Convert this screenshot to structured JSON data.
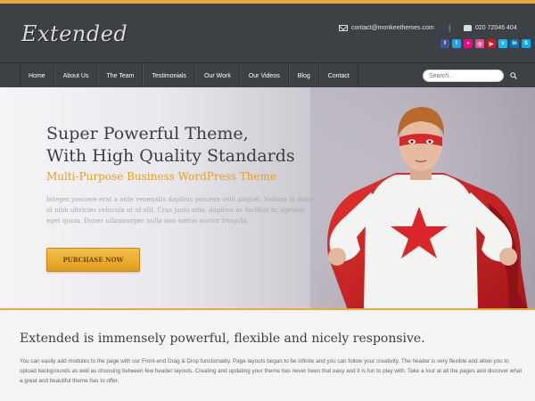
{
  "brand": {
    "logo_text": "Extended"
  },
  "contact": {
    "email": "contact@monkeethemes.com",
    "separator": "|",
    "phone": "020 72046 404"
  },
  "socials": [
    {
      "name": "facebook-icon",
      "glyph": "f",
      "color": "#3b5998"
    },
    {
      "name": "twitter-icon",
      "glyph": "t",
      "color": "#1da1f2"
    },
    {
      "name": "flickr-icon",
      "glyph": "●",
      "color": "#ff0084"
    },
    {
      "name": "dribbble-icon",
      "glyph": "◎",
      "color": "#ea4c89"
    },
    {
      "name": "youtube-icon",
      "glyph": "▶",
      "color": "#cc181e"
    },
    {
      "name": "vimeo-icon",
      "glyph": "v",
      "color": "#1ab7ea"
    },
    {
      "name": "linkedin-icon",
      "glyph": "in",
      "color": "#0077b5"
    },
    {
      "name": "skype-icon",
      "glyph": "S",
      "color": "#00aff0"
    }
  ],
  "nav": {
    "items": [
      "Home",
      "About Us",
      "The Team",
      "Testimonials",
      "Our Work",
      "Our Videos",
      "Blog",
      "Contact"
    ],
    "search_placeholder": "Search.."
  },
  "hero": {
    "title_line1": "Super Powerful Theme,",
    "title_line2": "With High Quality Standards",
    "subtitle": "Multi-Purpose Business WordPress Theme",
    "body": "Integer posuere erat a ante venenatis dapibus posuere velit aliquet. Nullam id dolor id nibh ultricies vehicula ut id elit. Cras justo odio, dapibus ac facilisis in, egestas eget quam. Donec ullamcorper nulla non metus auctor fringilla.",
    "button_label": "PURCHASE NOW"
  },
  "intro": {
    "title": "Extended is immensely powerful, flexible and nicely responsive.",
    "body": "You can easily add modules to the page with our Front-end Drag & Drop functionality. Page layouts began to be infinite and you can follow your creativity. The header is very flexible and allow you to upload backgrounds as well as choosing between few header layouts. Creating and updating your theme has never been that easy and it is fun to play with. Take a tour at all the pages and discover what a great and beautiful theme has to offer."
  },
  "colors": {
    "accent": "#e8a93a",
    "header_bg": "#3d4145",
    "button": "#f0b43a",
    "cape_red": "#d9262a"
  }
}
